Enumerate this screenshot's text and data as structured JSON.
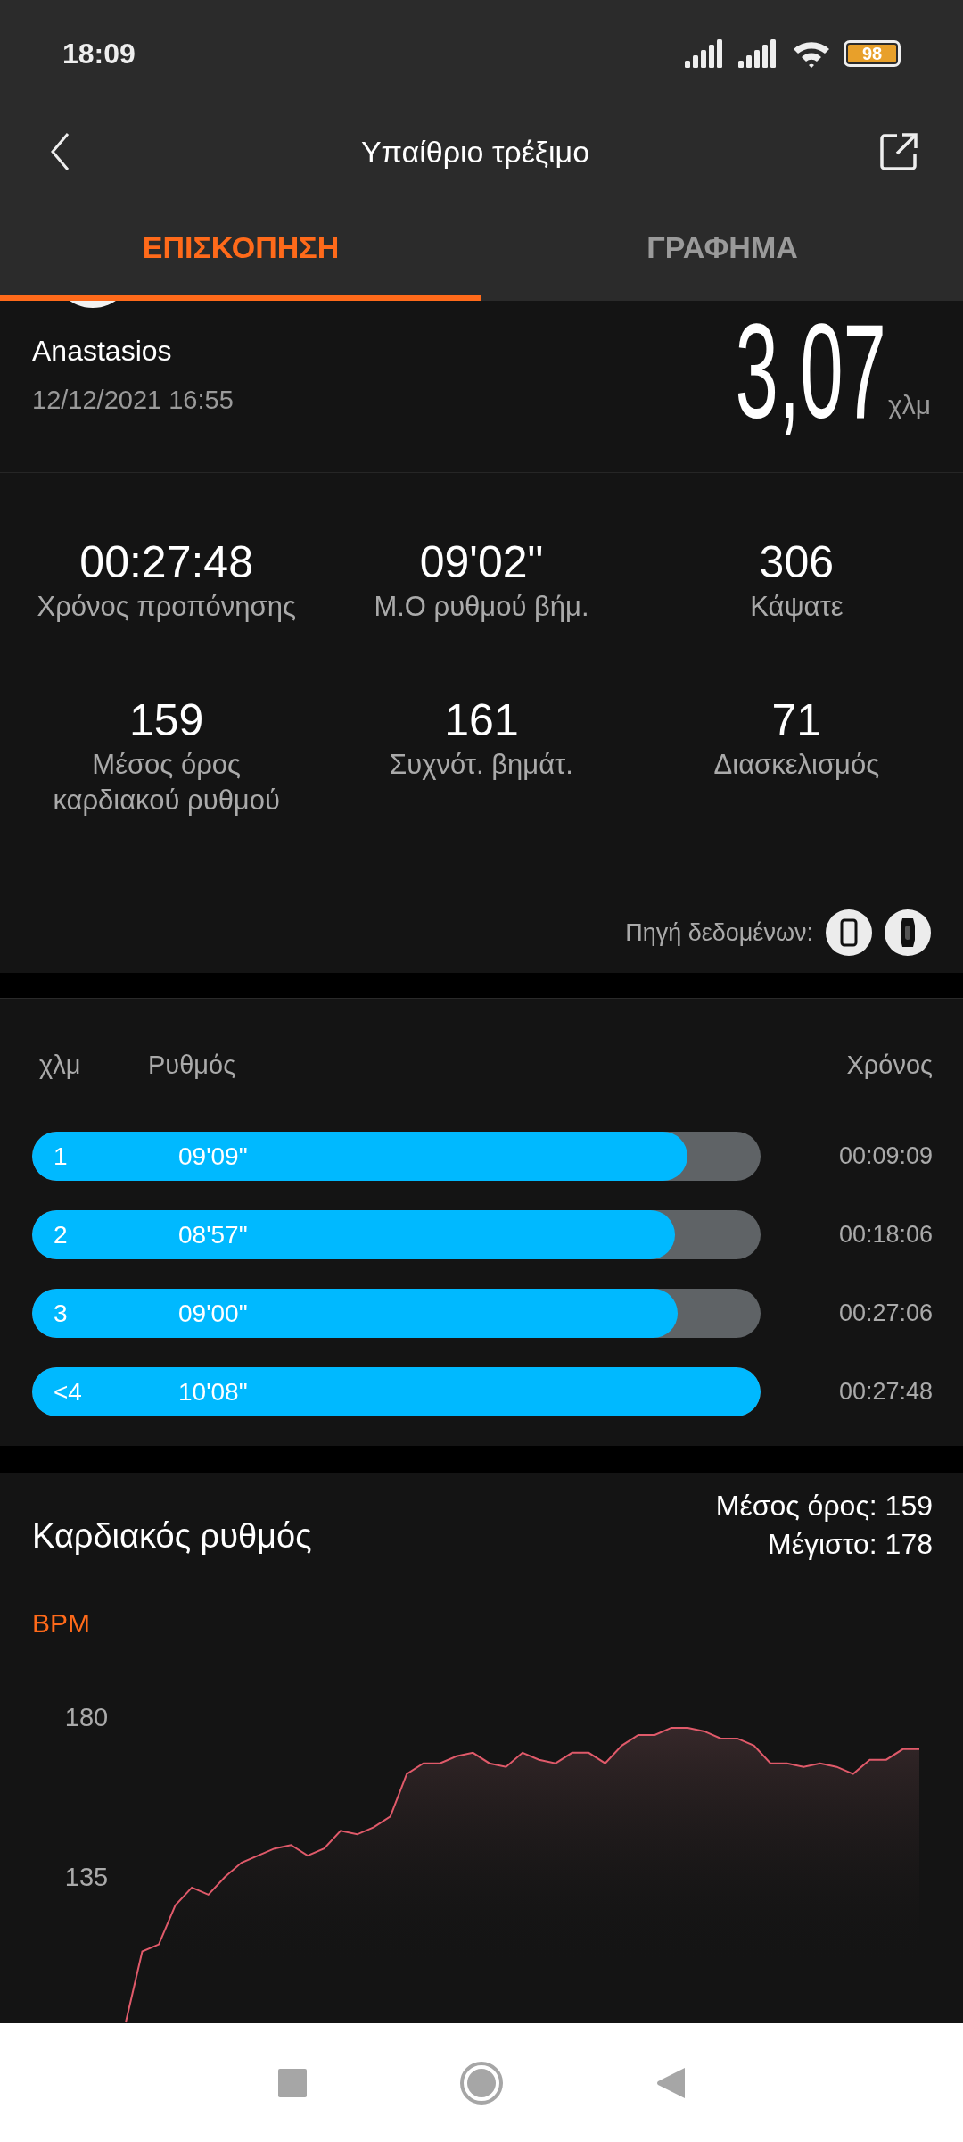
{
  "status_bar": {
    "time": "18:09",
    "battery": "98"
  },
  "app_bar": {
    "title": "Υπαίθριο τρέξιμο"
  },
  "tabs": [
    {
      "label": "ΕΠΙΣΚΟΠΗΣΗ",
      "selected": true
    },
    {
      "label": "ΓΡΑΦΗΜΑ",
      "selected": false
    }
  ],
  "summary": {
    "user": "Anastasios",
    "date": "12/12/2021 16:55",
    "distance": "3,07",
    "unit": "χλμ"
  },
  "stats": [
    {
      "value": "00:27:48",
      "label": "Χρόνος προπόνησης"
    },
    {
      "value": "09'02\"",
      "label": "Μ.Ο ρυθμού βήμ."
    },
    {
      "value": "306",
      "label": "Κάψατε"
    },
    {
      "value": "159",
      "label": "Μέσος όρος καρδιακού ρυθμού"
    },
    {
      "value": "161",
      "label": "Συχνότ. βημάτ."
    },
    {
      "value": "71",
      "label": "Διασκελισμός"
    }
  ],
  "data_source": {
    "label": "Πηγή δεδομένων:"
  },
  "splits": {
    "columns": [
      "χλμ",
      "Ρυθμός",
      "Χρόνος"
    ],
    "rows": [
      {
        "km": "1",
        "pace": "09'09\"",
        "time": "00:09:09",
        "level": 0.9
      },
      {
        "km": "2",
        "pace": "08'57\"",
        "time": "00:18:06",
        "level": 0.882
      },
      {
        "km": "3",
        "pace": "09'00\"",
        "time": "00:27:06",
        "level": 0.886
      },
      {
        "km": "<4",
        "pace": "10'08\"",
        "time": "00:27:48",
        "level": 1
      }
    ]
  },
  "heart_rate": {
    "title": "Καρδιακός ρυθμός",
    "average": "Μέσος όρος: 159",
    "max": "Μέγιστο: 178",
    "axis_label": "BPM",
    "axis_ticks": [
      "180",
      "135"
    ]
  }
}
